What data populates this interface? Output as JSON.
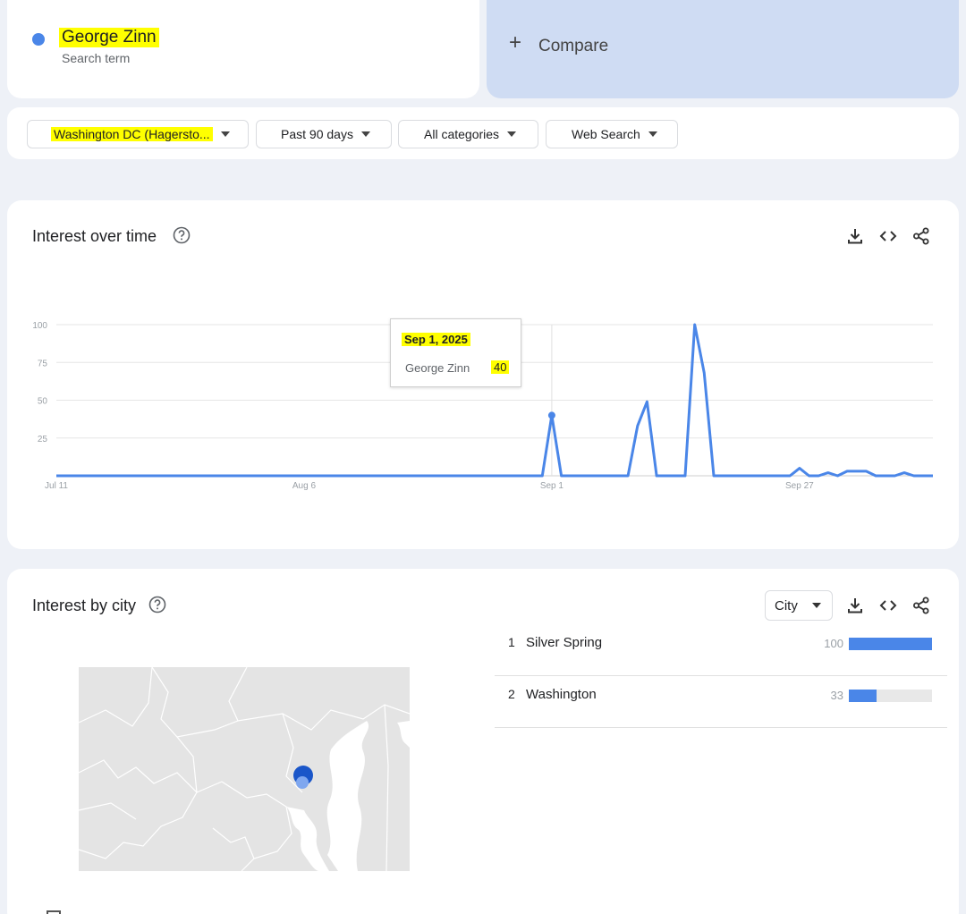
{
  "search_term": {
    "name": "George Zinn",
    "subtitle": "Search term",
    "dot_color": "#4a86e8"
  },
  "compare": {
    "label": "Compare"
  },
  "filters": [
    {
      "label": "Washington DC (Hagersto...",
      "highlighted": true
    },
    {
      "label": "Past 90 days"
    },
    {
      "label": "All categories"
    },
    {
      "label": "Web Search"
    }
  ],
  "interest_over_time": {
    "title": "Interest over time",
    "tools": [
      "download-icon",
      "embed-icon",
      "share-icon"
    ],
    "tooltip": {
      "date": "Sep 1, 2025",
      "series": "George Zinn",
      "value": "40"
    }
  },
  "chart_data": {
    "type": "line",
    "x_labels": [
      "Jul 11",
      "Aug 6",
      "Sep 1",
      "Sep 27"
    ],
    "ylim": [
      0,
      100
    ],
    "y_ticks": [
      25,
      50,
      75,
      100
    ],
    "grid": true,
    "series": [
      {
        "name": "George Zinn",
        "color": "#4a86e8",
        "values": [
          0,
          0,
          0,
          0,
          0,
          0,
          0,
          0,
          0,
          0,
          0,
          0,
          0,
          0,
          0,
          0,
          0,
          0,
          0,
          0,
          0,
          0,
          0,
          0,
          0,
          0,
          0,
          0,
          0,
          0,
          0,
          0,
          0,
          0,
          0,
          0,
          0,
          0,
          0,
          0,
          0,
          0,
          0,
          0,
          0,
          0,
          0,
          0,
          0,
          0,
          0,
          0,
          40,
          0,
          0,
          0,
          0,
          0,
          0,
          0,
          0,
          33,
          49,
          0,
          0,
          0,
          0,
          100,
          68,
          0,
          0,
          0,
          0,
          0,
          0,
          0,
          0,
          0,
          5,
          0,
          0,
          2,
          0,
          3,
          3,
          3,
          0,
          0,
          0,
          2,
          0,
          0,
          0
        ]
      }
    ],
    "highlight_index": 52
  },
  "interest_by_city": {
    "title": "Interest by city",
    "select_label": "City",
    "tools": [
      "download-icon",
      "embed-icon",
      "share-icon"
    ],
    "rows": [
      {
        "rank": "1",
        "name": "Silver Spring",
        "value": "100",
        "fraction": 1.0
      },
      {
        "rank": "2",
        "name": "Washington",
        "value": "33",
        "fraction": 0.33
      }
    ]
  }
}
